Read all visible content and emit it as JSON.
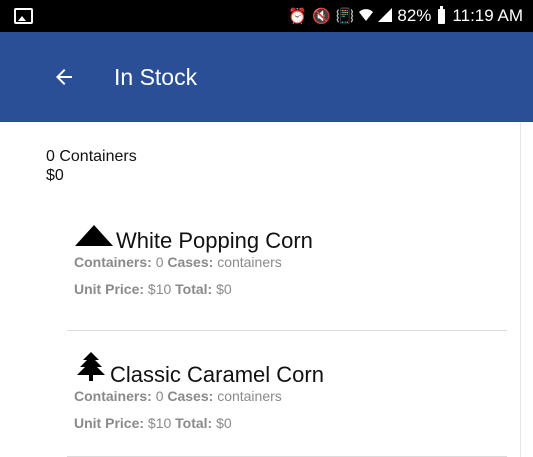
{
  "status_bar": {
    "icons": [
      "gallery-icon",
      "alarm-clock-icon",
      "mute-icon",
      "vibrate-icon",
      "wifi-icon",
      "signal-icon",
      "battery-icon"
    ],
    "battery": "82%",
    "time": "11:19 AM"
  },
  "app_bar": {
    "back_icon": "arrow-left-icon",
    "title": "In Stock",
    "color": "#2a4f97"
  },
  "summary": {
    "containers": "0 Containers",
    "total": "$0"
  },
  "labels": {
    "containers": "Containers:",
    "cases": "Cases:",
    "unit_price": "Unit Price:",
    "total": "Total:"
  },
  "items": [
    {
      "icon": "triangle-icon",
      "name": "White Popping Corn",
      "containers": "0",
      "cases": "containers",
      "unit_price": "$10",
      "total": "$0"
    },
    {
      "icon": "tree-icon",
      "name": "Classic Caramel Corn",
      "containers": "0",
      "cases": "containers",
      "unit_price": "$10",
      "total": "$0"
    }
  ]
}
